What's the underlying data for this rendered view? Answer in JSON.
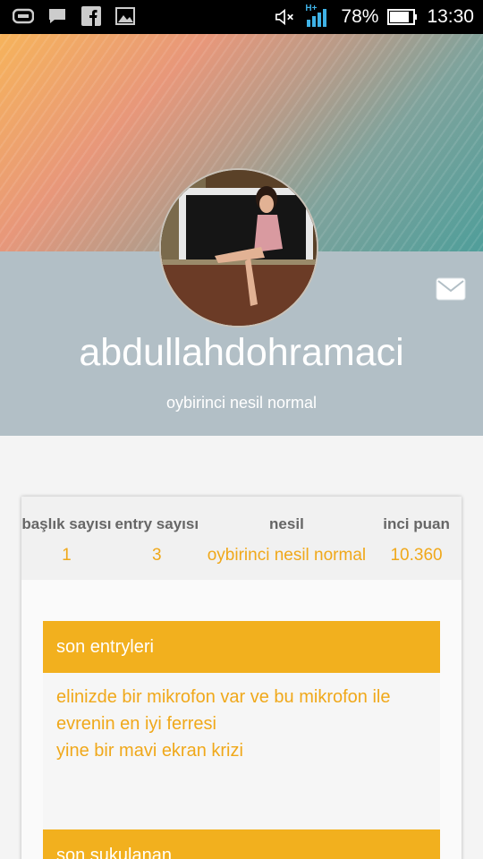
{
  "status_bar": {
    "battery": "78%",
    "time": "13:30",
    "network": "H+"
  },
  "profile": {
    "username": "abdullahdohramaci",
    "generation": "oybirinci nesil normal"
  },
  "stats": [
    {
      "label": "başlık sayısı",
      "value": "1"
    },
    {
      "label": "entry sayısı",
      "value": "3"
    },
    {
      "label": "nesil",
      "value": "oybirinci nesil normal"
    },
    {
      "label": "inci puan",
      "value": "10.360"
    }
  ],
  "sections": {
    "recent_entries": {
      "title": "son entryleri",
      "items": [
        "elinizde bir mikrofon var ve bu mikrofon ile evrenin en iyi ferresi",
        "yine bir mavi ekran krizi"
      ]
    },
    "recent_liked": {
      "title": "son şukulanan"
    }
  },
  "colors": {
    "accent": "#f2b01e",
    "header_grey": "#b2bfc6",
    "status_bar": "#000000"
  }
}
